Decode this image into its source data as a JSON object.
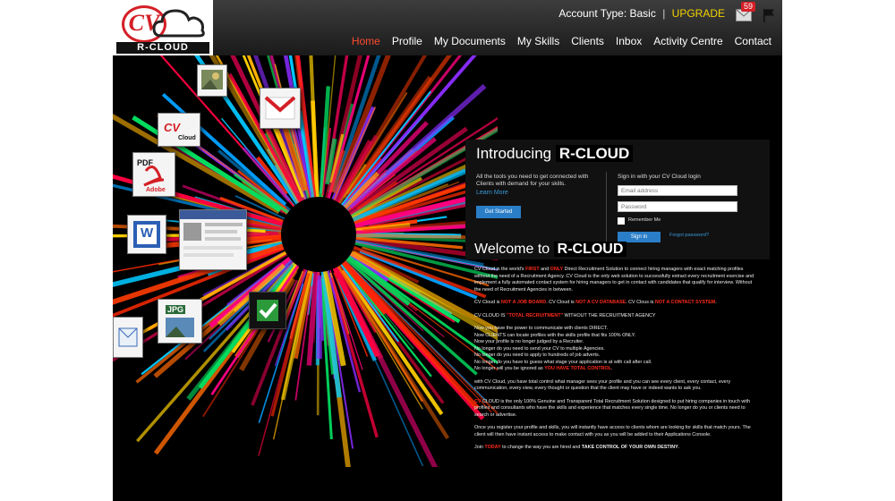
{
  "header": {
    "logo_letters": "CV",
    "logo_text": "R-CLOUD",
    "account_label": "Account Type: Basic",
    "separator": "|",
    "upgrade_label": "UPGRADE",
    "notification_count": "59",
    "mail_icon": "mail-icon",
    "flag_icon": "flag-icon"
  },
  "nav": {
    "items": [
      {
        "label": "Home",
        "active": true
      },
      {
        "label": "Profile"
      },
      {
        "label": "My Documents"
      },
      {
        "label": "My Skills"
      },
      {
        "label": "Clients"
      },
      {
        "label": "Inbox"
      },
      {
        "label": "Activity Centre"
      },
      {
        "label": "Contact"
      }
    ]
  },
  "hero_tiles": {
    "gmail": "gmail-icon",
    "cv_cloud": "Cloud",
    "cv_letters": "CV",
    "pdf_label": "PDF",
    "adobe_label": "Adobe",
    "word_label": "W",
    "jpg_label": "JPG",
    "check": "checkmark-icon"
  },
  "intro": {
    "heading": "Introducing",
    "brand": "R-CLOUD",
    "tagline": "All the tools you need to get connected with Clients with demand for your skills.",
    "learn_more": "Learn More",
    "get_started": "Get Started",
    "signin_title": "Sign in with your CV Cloud login",
    "email_placeholder": "Email address",
    "password_placeholder": "Password",
    "remember": "Remember Me",
    "signin_button": "Sign in",
    "forgot": "Forgot password?"
  },
  "welcome": {
    "heading": "Welcome to",
    "brand": "R-CLOUD",
    "p1": {
      "a": "CV Cloud is the world's ",
      "first": "FIRST",
      "and": " and ",
      "only": "ONLY",
      "b": " Direct Recruitment Solution to connect hiring managers with exact matching profiles without the need of a Recruitment Agency. CV Cloud is the only web solution to successfully extract every recruitment exercise and implement a fully automated contact system for hiring managers to get in contact with candidates that qualify for interview. Without the need of Recruitment Agencies in between."
    },
    "p2": {
      "a": "CV Cloud is ",
      "b": "NOT A JOB BOARD",
      "c": ". CV Cloud is ",
      "d": "NOT A CV DATABASE",
      "e": ". CV Clous is ",
      "f": "NOT A CONTACT SYSTEM",
      "g": "."
    },
    "p3": {
      "a": "CV CLOUD IS ",
      "b": "\"TOTAL RECRUITMENT\"",
      "c": " WITHOUT THE RECRUITMENT AGENCY"
    },
    "p4_lines": [
      "Now you have the power to communicate with clients DIRECT.",
      "Now CLIENTS can locate profiles with the skills profile that fits 100% ONLY.",
      "Now your profile is no longer judged by a Recruiter.",
      "No longer do you need to send your CV to multiple Agencies.",
      "No longer do you need to apply to hundreds of job adverts.",
      "No longer do you have to guess what stage your application is at with call after call."
    ],
    "p4_last_a": "No longer will you be ignored as ",
    "p4_last_b": "YOU HAVE TOTAL CONTROL",
    "p4_last_c": ".",
    "p5": "with CV Cloud, you have total control what manager sees your profile and you can see every client, every contact, every communication, every view, every thought or question that the client may have or indeed wants to ask you.",
    "p6": {
      "a": "CV",
      "b": " CLOUD is the only 100% Genuine and Transparent Total Recruitment Solution designed to put hiring companies in touch with profiles and consultants who have the skills and experience that matches every single time. No longer do you or clients need to search or advertise."
    },
    "p7": "Once you register your profile and skills, you will instantly have access to clients whom are looking for skills that match yours. The client will then have instant access to make contact with you as you will be added to their Applications Console.",
    "p8": {
      "a": "Join ",
      "b": "TODAY",
      "c": " to change the way you are hired and ",
      "d": "TAKE CONTROL OF YOUR OWN DESTINY",
      "e": "."
    }
  },
  "colors": {
    "accent_red": "#d41f26",
    "upgrade_yellow": "#f2d300",
    "link_blue": "#3a9ad9",
    "button_blue": "#2a7ec8"
  }
}
